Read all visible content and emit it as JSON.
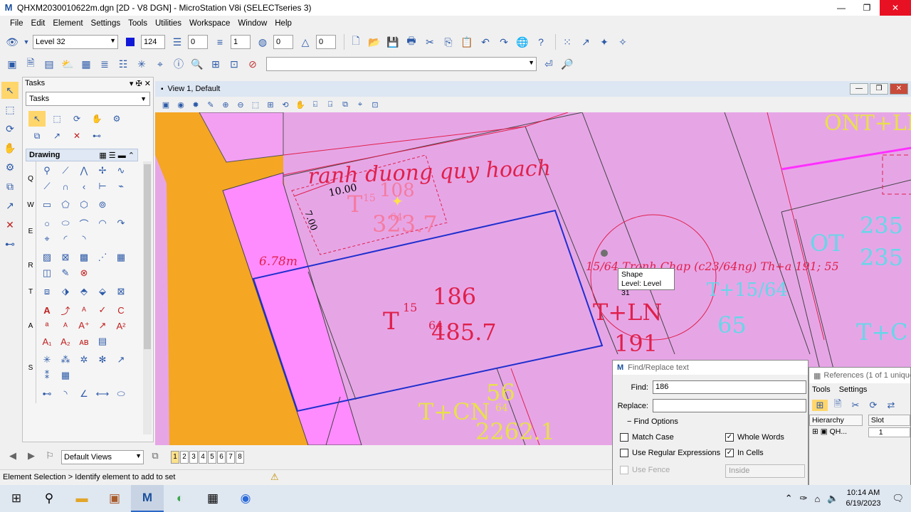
{
  "window": {
    "title": "QHXM2030010622m.dgn [2D - V8 DGN] - MicroStation V8i (SELECTseries 3)",
    "app_icon": "M"
  },
  "menu": [
    "File",
    "Edit",
    "Element",
    "Settings",
    "Tools",
    "Utilities",
    "Workspace",
    "Window",
    "Help"
  ],
  "attributes": {
    "level": "Level 32",
    "color": "124",
    "line_style": "0",
    "weight": "1",
    "transparency": "0",
    "priority": "0"
  },
  "tasks_panel": {
    "header": "Tasks",
    "combo": "Tasks",
    "drawing_header": "Drawing",
    "row_letters": [
      "Q",
      "W",
      "E",
      "R",
      "T",
      "A",
      "S"
    ]
  },
  "view": {
    "title": "View 1, Default"
  },
  "drawing": {
    "annotation": "ranh duong quy hoach",
    "dim_10": "10.00",
    "dim_7": "7.00",
    "dim_678": "6.78m",
    "parcel1": {
      "code": "T",
      "sheet": "15",
      "num": "108",
      "area": "323.7",
      "sub": "64"
    },
    "parcel2": {
      "code": "T",
      "sheet": "15",
      "num": "186",
      "area": "485.7",
      "sub": "64"
    },
    "parcel3": {
      "code": "T+LN",
      "num": "191"
    },
    "parcel4": {
      "code": "T+CN",
      "num": "56",
      "area": "2262.1",
      "sub": "64"
    },
    "owner_text": "15/64   Tranh Chap (c23/64ng) Th+a 191; 55",
    "top_right": "ONT+LN",
    "right_code": "OT",
    "right_num1": "235",
    "right_num2": "235",
    "mid_right1": "T+15/64",
    "mid_right2": "65",
    "mid_right3": "T+C"
  },
  "tooltip": {
    "line1": "Shape",
    "line2": "Level: Level 31"
  },
  "find_dialog": {
    "title": "Find/Replace text",
    "find_label": "Find:",
    "find_value": "186",
    "replace_label": "Replace:",
    "replace_value": "",
    "options_header": "Find Options",
    "match_case": "Match Case",
    "whole_words": "Whole Words",
    "regex": "Use Regular Expressions",
    "in_cells": "In Cells",
    "use_fence": "Use Fence",
    "fence_mode": "Inside"
  },
  "ref_dialog": {
    "title": "References (1 of 1 unique",
    "menu_tools": "Tools",
    "menu_settings": "Settings",
    "col_hierarchy": "Hierarchy",
    "col_slot": "Slot",
    "tree_item": "QH...",
    "slot_value": "1"
  },
  "view_groups": {
    "combo": "Default Views",
    "numbers": [
      "1",
      "2",
      "3",
      "4",
      "5",
      "6",
      "7",
      "8"
    ]
  },
  "status": {
    "prompt": "Element Selection > Identify element to add to set"
  },
  "taskbar": {
    "time": "10:14 AM",
    "date": "6/19/2023"
  },
  "colors": {
    "canvas_pink": "#e6a6e6",
    "road_orange": "#f5a623",
    "parcel_red": "#e0204c",
    "selection_blue": "#1f2fcf",
    "label_yellow": "#e8e04a",
    "cyan": "#66d6e8"
  }
}
